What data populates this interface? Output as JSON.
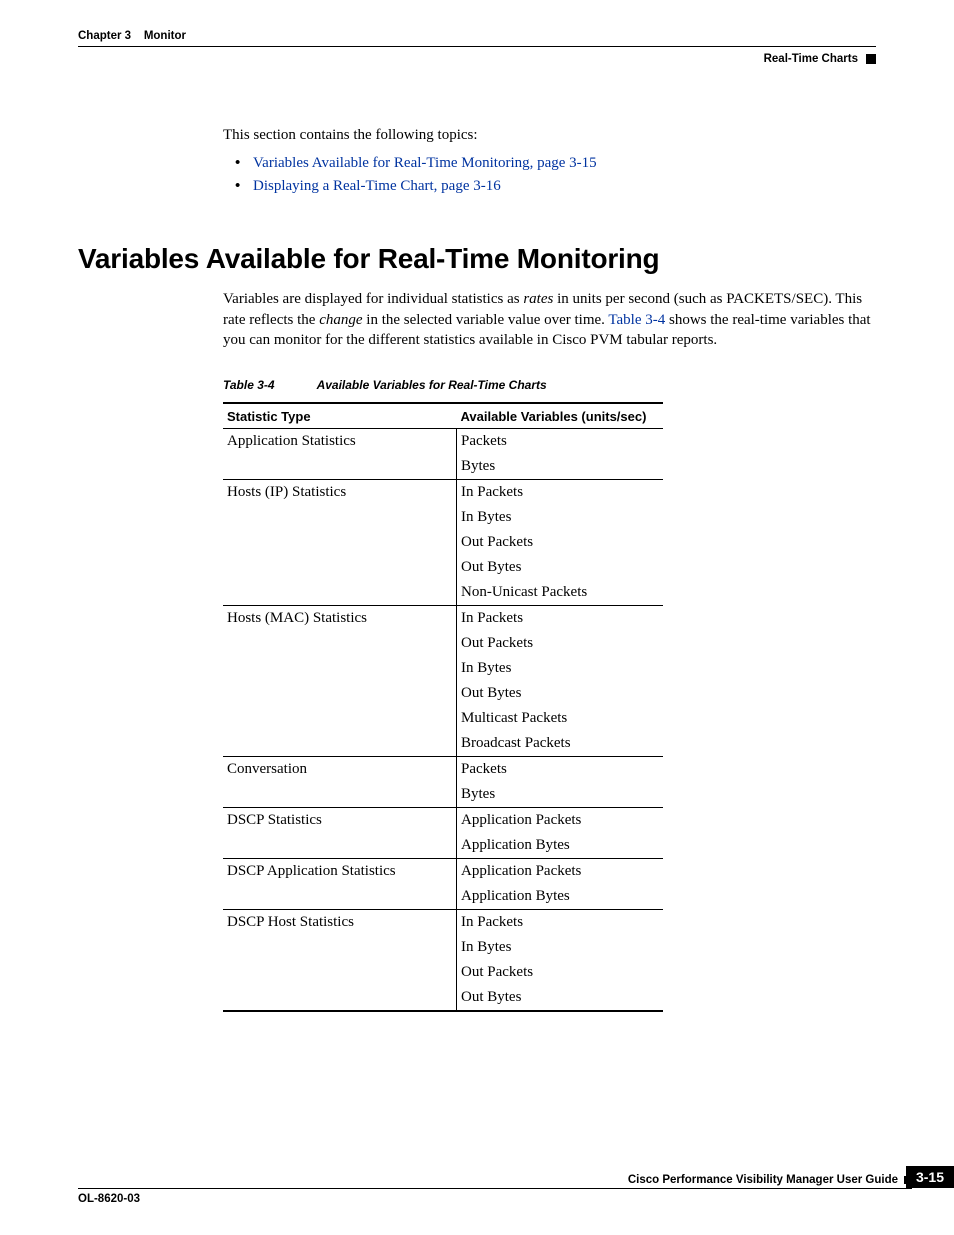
{
  "header": {
    "chapter": "Chapter 3",
    "chapter_title": "Monitor",
    "section_label": "Real-Time Charts"
  },
  "intro": {
    "lead": "This section contains the following topics:",
    "bullets": [
      {
        "text": "Variables Available for Real-Time Monitoring, page 3-15"
      },
      {
        "text": "Displaying a Real-Time Chart, page 3-16"
      }
    ]
  },
  "heading": "Variables Available for Real-Time Monitoring",
  "para": {
    "p1a": "Variables are displayed for individual statistics as ",
    "rates": "rates",
    "p1b": " in units per second (such as PACKETS/SEC). This rate reflects the ",
    "change": "change",
    "p1c": " in the selected variable value over time. ",
    "tableref": "Table 3-4",
    "p1d": " shows the real-time variables that you can monitor for the different statistics available in Cisco PVM tabular reports."
  },
  "table_caption": {
    "num": "Table 3-4",
    "title": "Available Variables for Real-Time Charts"
  },
  "table": {
    "head": {
      "c1": "Statistic Type",
      "c2": "Available Variables (units/sec)"
    },
    "groups": [
      {
        "type": "Application Statistics",
        "vars": [
          "Packets",
          "Bytes"
        ]
      },
      {
        "type": "Hosts (IP) Statistics",
        "vars": [
          "In Packets",
          "In Bytes",
          "Out Packets",
          "Out Bytes",
          "Non-Unicast Packets"
        ]
      },
      {
        "type": "Hosts (MAC) Statistics",
        "vars": [
          "In Packets",
          "Out Packets",
          "In Bytes",
          "Out Bytes",
          "Multicast Packets",
          "Broadcast Packets"
        ]
      },
      {
        "type": "Conversation",
        "vars": [
          "Packets",
          "Bytes"
        ]
      },
      {
        "type": "DSCP Statistics",
        "vars": [
          "Application Packets",
          "Application Bytes"
        ]
      },
      {
        "type": "DSCP Application Statistics",
        "vars": [
          "Application Packets",
          "Application Bytes"
        ]
      },
      {
        "type": "DSCP Host Statistics",
        "vars": [
          "In Packets",
          "In Bytes",
          "Out Packets",
          "Out Bytes"
        ]
      }
    ]
  },
  "footer": {
    "guide_title": "Cisco Performance Visibility Manager User Guide",
    "doc_id": "OL-8620-03",
    "page_num": "3-15"
  }
}
